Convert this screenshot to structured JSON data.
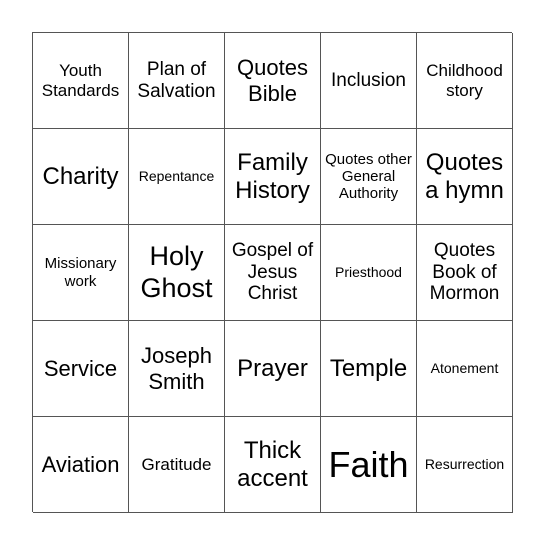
{
  "board": {
    "cells": [
      "Youth Standards",
      "Plan of Salvation",
      "Quotes Bible",
      "Inclusion",
      "Childhood story",
      "Charity",
      "Repentance",
      "Family History",
      "Quotes other General Authority",
      "Quotes a hymn",
      "Missionary work",
      "Holy Ghost",
      "Gospel of Jesus Christ",
      "Priesthood",
      "Quotes Book of Mormon",
      "Service",
      "Joseph Smith",
      "Prayer",
      "Temple",
      "Atonement",
      "Aviation",
      "Gratitude",
      "Thick accent",
      "Faith",
      "Resurrection"
    ]
  }
}
